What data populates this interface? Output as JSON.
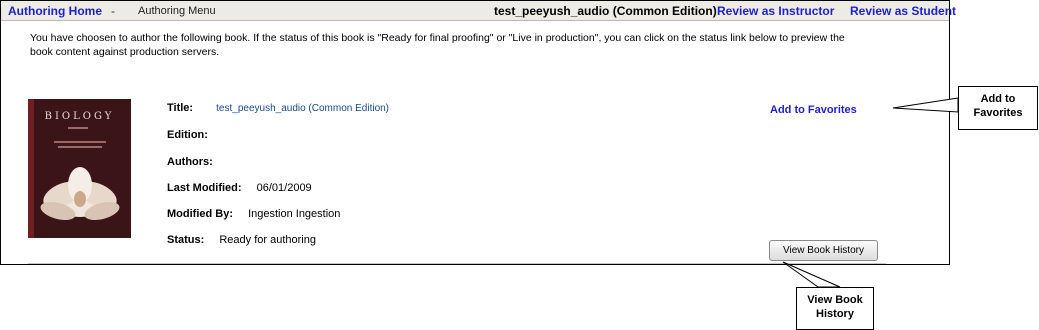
{
  "topbar": {
    "home_link": "Authoring Home",
    "separator": "-",
    "menu_label": "Authoring Menu",
    "book_title": "test_peeyush_audio (Common Edition)",
    "review_instructor": "Review as Instructor",
    "review_student": "Review as Student"
  },
  "intro_text": "You have choosen to author the following book. If the status of this book is \"Ready for final proofing\" or \"Live in production\", you can click on the status link below to preview the book content against production servers.",
  "cover": {
    "title": "BIOLOGY"
  },
  "details": {
    "title_label": "Title:",
    "title_value": "test_peeyush_audio (Common Edition)",
    "edition_label": "Edition:",
    "edition_value": "",
    "authors_label": "Authors:",
    "authors_value": "",
    "last_modified_label": "Last Modified:",
    "last_modified_value": "06/01/2009",
    "modified_by_label": "Modified By:",
    "modified_by_value": "Ingestion Ingestion",
    "status_label": "Status:",
    "status_value": "Ready for authoring"
  },
  "actions": {
    "add_favorites": "Add to Favorites",
    "view_history": "View Book History"
  },
  "callouts": {
    "favorites_line1": "Add to",
    "favorites_line2": "Favorites",
    "history_line1": "View Book",
    "history_line2": "History"
  },
  "colors": {
    "link": "#1f1fcc",
    "topbar_bg": "#ecebe4",
    "title_value": "#1a4a8a"
  }
}
